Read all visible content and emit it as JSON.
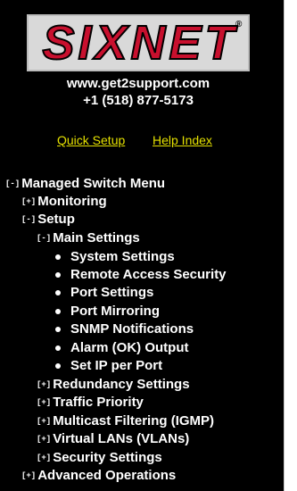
{
  "logo": {
    "text": "SIXNET",
    "reg_mark": "®"
  },
  "contact": {
    "url": "www.get2support.com",
    "phone": "+1 (518) 877-5173"
  },
  "links": {
    "quick_setup": "Quick Setup",
    "help_index": "Help Index"
  },
  "colors": {
    "background": "#000000",
    "link": "#e4e000",
    "logo_red": "#c8102e",
    "text": "#ffffff"
  },
  "menu": {
    "root": {
      "toggle": "[-]",
      "label": "Managed Switch Menu"
    },
    "monitoring": {
      "toggle": "[+]",
      "label": "Monitoring"
    },
    "setup": {
      "toggle": "[-]",
      "label": "Setup"
    },
    "main_settings": {
      "toggle": "[-]",
      "label": "Main Settings"
    },
    "main_items": [
      "System Settings",
      "Remote Access Security",
      "Port Settings",
      "Port Mirroring",
      "SNMP Notifications",
      "Alarm (OK) Output",
      "Set IP per Port"
    ],
    "redundancy": {
      "toggle": "[+]",
      "label": "Redundancy Settings"
    },
    "traffic": {
      "toggle": "[+]",
      "label": "Traffic Priority"
    },
    "multicast": {
      "toggle": "[+]",
      "label": "Multicast Filtering (IGMP)"
    },
    "vlans": {
      "toggle": "[+]",
      "label": "Virtual LANs (VLANs)"
    },
    "security": {
      "toggle": "[+]",
      "label": "Security Settings"
    },
    "advanced": {
      "toggle": "[+]",
      "label": "Advanced Operations"
    }
  }
}
